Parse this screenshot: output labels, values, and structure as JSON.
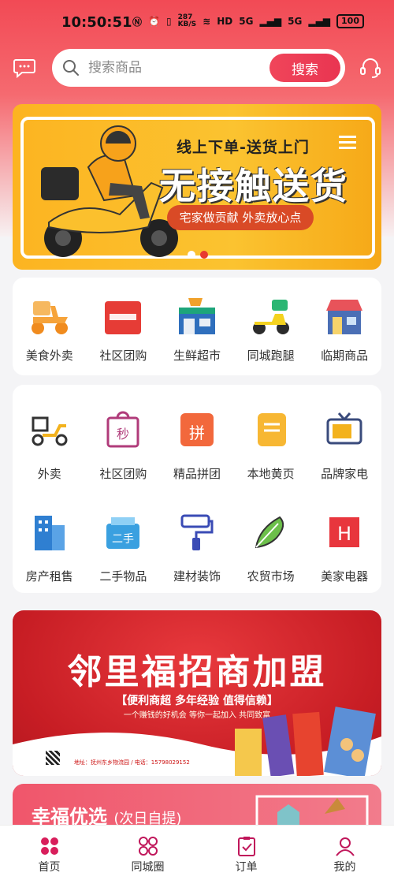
{
  "status_bar": {
    "time": "10:50:51",
    "speed": "287\nKB/S",
    "net1": "5G",
    "net2": "5G",
    "battery": "100"
  },
  "header": {
    "search_placeholder": "搜索商品",
    "search_button": "搜索"
  },
  "banner": {
    "subtitle": "线上下单-送货上门",
    "title": "无接触送货",
    "pill": "宅家做贡献 外卖放心点"
  },
  "quick_menu": [
    {
      "label": "美食外卖",
      "icon": "scooter-food-icon"
    },
    {
      "label": "社区团购",
      "icon": "shopping-bag-icon"
    },
    {
      "label": "生鲜超市",
      "icon": "supermarket-icon"
    },
    {
      "label": "同城跑腿",
      "icon": "delivery-scooter-icon"
    },
    {
      "label": "临期商品",
      "icon": "shop-icon"
    }
  ],
  "services": [
    {
      "label": "外卖",
      "icon": "delivery-icon"
    },
    {
      "label": "社区团购",
      "icon": "flash-sale-bag-icon"
    },
    {
      "label": "精品拼团",
      "icon": "group-buy-icon"
    },
    {
      "label": "本地黄页",
      "icon": "notebook-icon"
    },
    {
      "label": "品牌家电",
      "icon": "tv-icon"
    },
    {
      "label": "房产租售",
      "icon": "building-icon"
    },
    {
      "label": "二手物品",
      "icon": "second-hand-box-icon"
    },
    {
      "label": "建材装饰",
      "icon": "paint-roller-icon"
    },
    {
      "label": "农贸市场",
      "icon": "vegetable-icon"
    },
    {
      "label": "美家电器",
      "icon": "h-appliance-icon"
    }
  ],
  "promo": {
    "title": "邻里福招商加盟",
    "subtitle": "【便利商超 多年经验 值得信赖】",
    "tagline": "一个赚钱的好机会 等你一起加入 共同致富",
    "address": "地址：抚州东乡物流园 / 电话：15798029152"
  },
  "card3": {
    "title": "幸福优选",
    "note": "(次日自提)"
  },
  "tabbar": [
    {
      "label": "首页",
      "icon": "home-grid-icon"
    },
    {
      "label": "同城圈",
      "icon": "circles-icon"
    },
    {
      "label": "订单",
      "icon": "order-clipboard-icon"
    },
    {
      "label": "我的",
      "icon": "user-icon"
    }
  ],
  "colors": {
    "accent": "#e93551",
    "banner_yellow": "#fbc330",
    "promo_red": "#c71d24"
  }
}
